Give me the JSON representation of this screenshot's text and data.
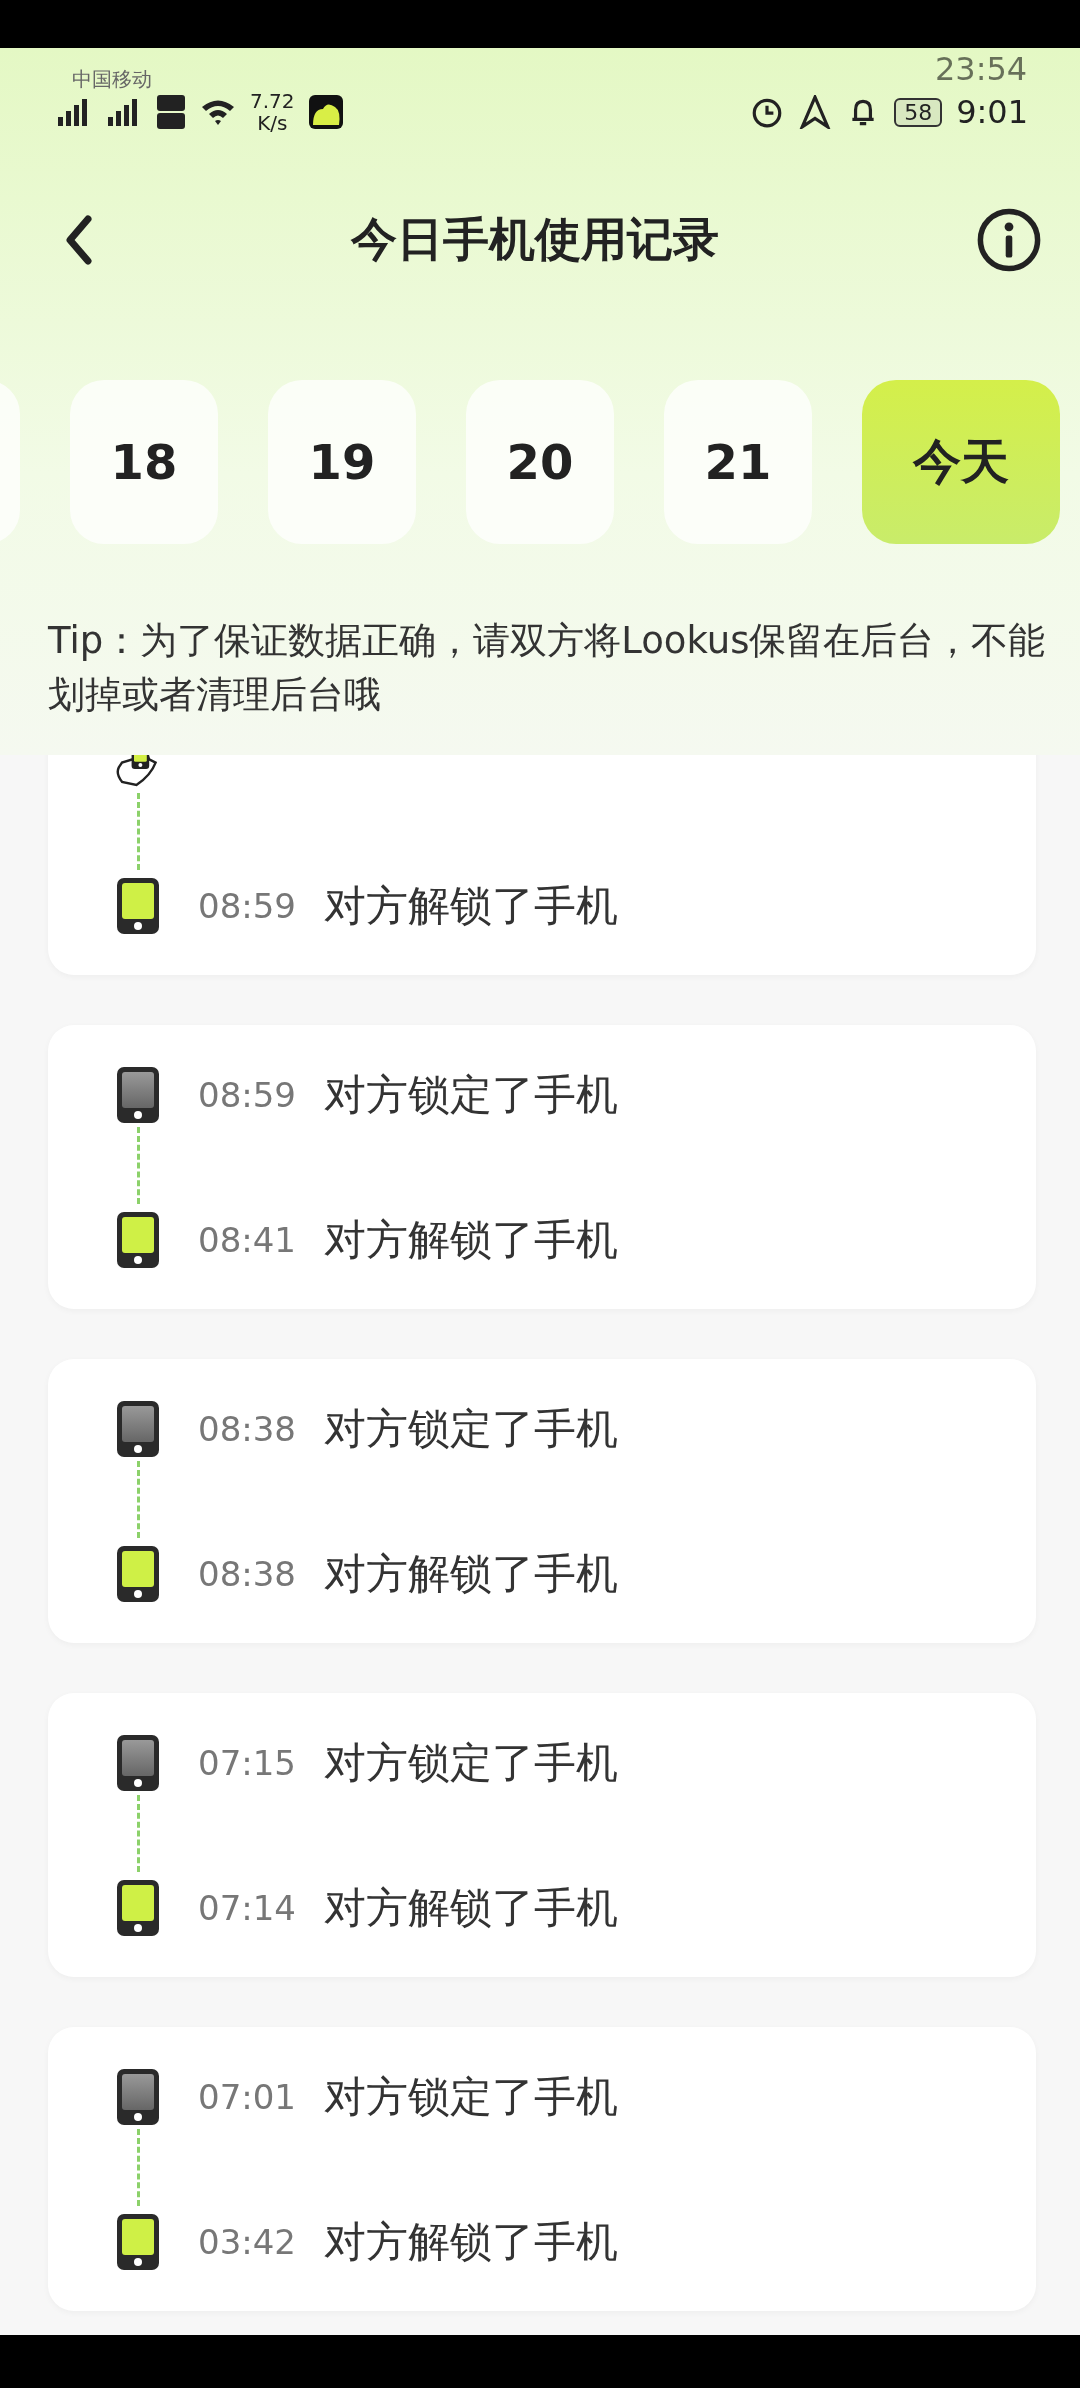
{
  "status_bar": {
    "ghost_carrier": "中国移动",
    "ghost_time": "23:54",
    "speed": "7.72",
    "speed_unit": "K/s",
    "battery": "58",
    "time": "9:01"
  },
  "header": {
    "title": "今日手机使用记录"
  },
  "dates": [
    {
      "label": "18",
      "selected": false
    },
    {
      "label": "19",
      "selected": false
    },
    {
      "label": "20",
      "selected": false
    },
    {
      "label": "21",
      "selected": false
    },
    {
      "label": "今天",
      "selected": true
    }
  ],
  "tip": "Tip：为了保证数据正确，请双方将Lookus保留在后台，不能划掉或者清理后台哦",
  "records": [
    {
      "events": [
        {
          "kind": "current"
        },
        {
          "kind": "unlock",
          "time": "08:59",
          "text": "对方解锁了手机"
        }
      ]
    },
    {
      "events": [
        {
          "kind": "lock",
          "time": "08:59",
          "text": "对方锁定了手机"
        },
        {
          "kind": "unlock",
          "time": "08:41",
          "text": "对方解锁了手机"
        }
      ]
    },
    {
      "events": [
        {
          "kind": "lock",
          "time": "08:38",
          "text": "对方锁定了手机"
        },
        {
          "kind": "unlock",
          "time": "08:38",
          "text": "对方解锁了手机"
        }
      ]
    },
    {
      "events": [
        {
          "kind": "lock",
          "time": "07:15",
          "text": "对方锁定了手机"
        },
        {
          "kind": "unlock",
          "time": "07:14",
          "text": "对方解锁了手机"
        }
      ]
    },
    {
      "events": [
        {
          "kind": "lock",
          "time": "07:01",
          "text": "对方锁定了手机"
        },
        {
          "kind": "unlock",
          "time": "03:42",
          "text": "对方解锁了手机"
        }
      ]
    }
  ]
}
